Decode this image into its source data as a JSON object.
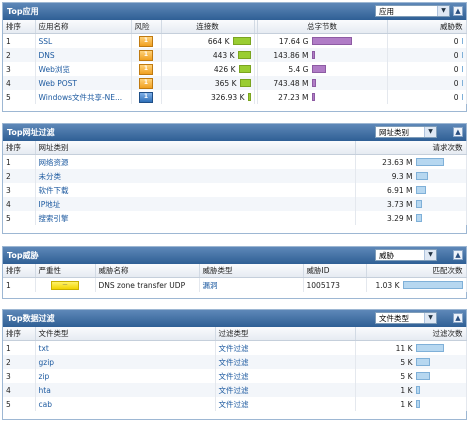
{
  "panels": {
    "top_apps": {
      "title": "Top应用",
      "select": "应用",
      "collapse": "▲",
      "headers": [
        "排序",
        "应用名称",
        "风险",
        "连接数",
        "",
        "总字节数",
        "威胁数"
      ],
      "rows": [
        {
          "rank": "1",
          "name": "SSL",
          "risk": "1",
          "conn": "664 K",
          "conn_frac": 1.0,
          "bytes": "17.64 G",
          "bytes_frac": 1.0,
          "threats": "0"
        },
        {
          "rank": "2",
          "name": "DNS",
          "risk": "1",
          "conn": "443 K",
          "conn_frac": 0.67,
          "bytes": "143.86 M",
          "bytes_frac": 0.0,
          "threats": "0"
        },
        {
          "rank": "3",
          "name": "Web浏览",
          "risk": "1",
          "conn": "426 K",
          "conn_frac": 0.64,
          "bytes": "5.4 G",
          "bytes_frac": 0.31,
          "threats": "0"
        },
        {
          "rank": "4",
          "name": "Web POST",
          "risk": "1",
          "conn": "365 K",
          "conn_frac": 0.55,
          "bytes": "743.48 M",
          "bytes_frac": 0.04,
          "threats": "0"
        },
        {
          "rank": "5",
          "name": "Windows文件共享-NE...",
          "risk": "1",
          "risk_style": "blue",
          "conn": "326.93 K",
          "conn_frac": 0.0,
          "bytes": "27.23 M",
          "bytes_frac": 0.0,
          "threats": "0"
        }
      ]
    },
    "top_url": {
      "title": "Top网址过滤",
      "select": "网址类别",
      "collapse": "▲",
      "headers": [
        "排序",
        "网址类别",
        "请求次数"
      ],
      "rows": [
        {
          "rank": "1",
          "name": "网络资源",
          "count": "23.63 M",
          "frac": 1.0
        },
        {
          "rank": "2",
          "name": "未分类",
          "count": "9.3 M",
          "frac": 0.39
        },
        {
          "rank": "3",
          "name": "软件下载",
          "count": "6.91 M",
          "frac": 0.29
        },
        {
          "rank": "4",
          "name": "IP地址",
          "count": "3.73 M",
          "frac": 0.16
        },
        {
          "rank": "5",
          "name": "搜索引擎",
          "count": "3.29 M",
          "frac": 0.14
        }
      ]
    },
    "top_threats": {
      "title": "Top威胁",
      "select": "威胁",
      "collapse": "▲",
      "headers": [
        "排序",
        "严重性",
        "威胁名称",
        "威胁类型",
        "威胁ID",
        "匹配次数"
      ],
      "rows": [
        {
          "rank": "1",
          "severity": "—",
          "name": "DNS zone transfer UDP",
          "type": "漏洞",
          "id": "1005173",
          "count": "1.03 K",
          "frac": 1.0
        }
      ]
    },
    "top_data": {
      "title": "Top数据过滤",
      "select": "文件类型",
      "collapse": "▲",
      "headers": [
        "排序",
        "文件类型",
        "过滤类型",
        "过滤次数"
      ],
      "rows": [
        {
          "rank": "1",
          "name": "txt",
          "type": "文件过滤",
          "count": "11 K",
          "frac": 1.0
        },
        {
          "rank": "2",
          "name": "gzip",
          "type": "文件过滤",
          "count": "5 K",
          "frac": 0.45
        },
        {
          "rank": "3",
          "name": "zip",
          "type": "文件过滤",
          "count": "5 K",
          "frac": 0.45
        },
        {
          "rank": "4",
          "name": "hta",
          "type": "文件过滤",
          "count": "1 K",
          "frac": 0.09
        },
        {
          "rank": "5",
          "name": "cab",
          "type": "文件过滤",
          "count": "1 K",
          "frac": 0.09
        }
      ]
    }
  }
}
